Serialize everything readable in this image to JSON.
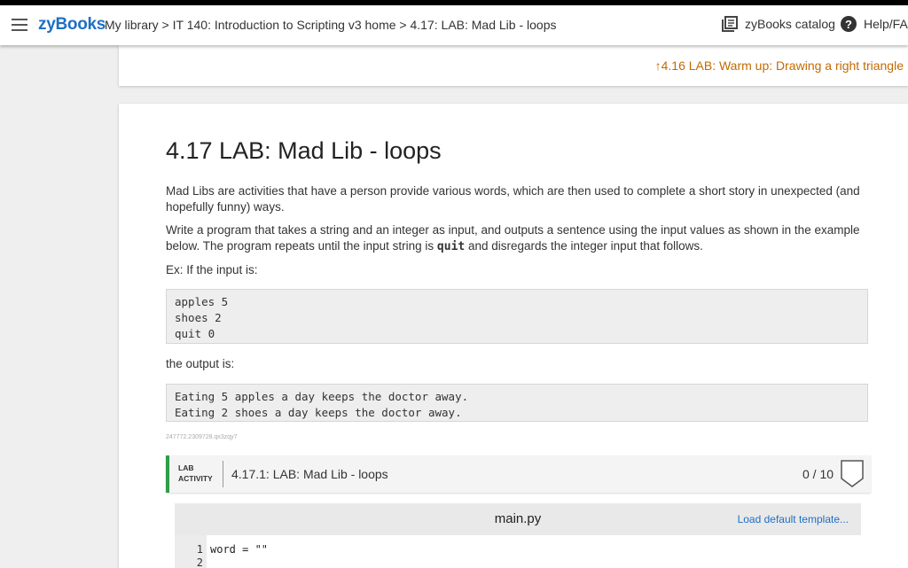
{
  "header": {
    "logo": "zyBooks",
    "breadcrumb": {
      "item1": "My library",
      "sep1": " > ",
      "item2": "IT 140: Introduction to Scripting v3 home",
      "sep2": " > ",
      "item3": "4.17: LAB: Mad Lib - loops"
    },
    "catalog_label": "zyBooks catalog",
    "help_label": "Help/FAQ"
  },
  "prev_section": {
    "arrow": "↑",
    "label": "4.16 LAB: Warm up: Drawing a right triangle"
  },
  "section": {
    "title": "4.17 LAB: Mad Lib - loops",
    "p1": "Mad Libs are activities that have a person provide various words, which are then used to complete a short story in unexpected (and hopefully funny) ways.",
    "p2_before": "Write a program that takes a string and an integer as input, and outputs a sentence using the input values as shown in the example below. The program repeats until the input string is ",
    "p2_code": "quit",
    "p2_after": " and disregards the integer input that follows.",
    "p3": "Ex: If the input is:",
    "input_lines": [
      "apples 5",
      "shoes 2",
      "quit 0"
    ],
    "p4": "the output is:",
    "output_lines": [
      "Eating 5 apples a day keeps the doctor away.",
      "Eating 2 shoes a day keeps the doctor away."
    ],
    "tiny_id": "247772.2309728.qx3zqy7"
  },
  "lab": {
    "tag_line1": "LAB",
    "tag_line2": "ACTIVITY",
    "title": "4.17.1: LAB: Mad Lib - loops",
    "score": "0 / 10",
    "accent": "#2e9e47"
  },
  "editor": {
    "filename": "main.py",
    "load_label": "Load default template...",
    "lines": [
      {
        "num": "1",
        "code": "word = \"\""
      },
      {
        "num": "2",
        "code": ""
      }
    ]
  },
  "colors": {
    "brand": "#1f6fc5",
    "link_orange": "#c46a00"
  }
}
